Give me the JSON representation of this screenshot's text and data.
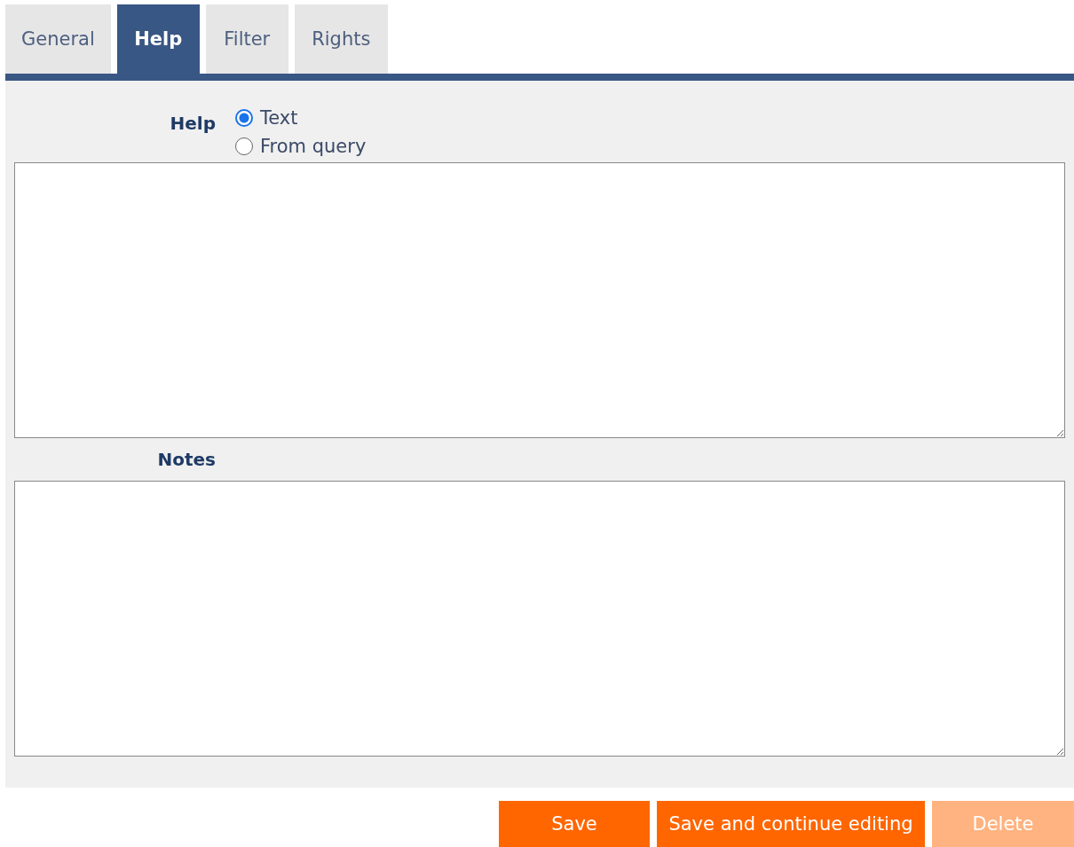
{
  "tabs": [
    {
      "label": "General",
      "selected": false
    },
    {
      "label": "Help",
      "selected": true
    },
    {
      "label": "Filter",
      "selected": false
    },
    {
      "label": "Rights",
      "selected": false
    }
  ],
  "help": {
    "label": "Help",
    "options": [
      {
        "label": "Text",
        "selected": true
      },
      {
        "label": "From query",
        "selected": false
      }
    ]
  },
  "notes": {
    "label": "Notes"
  },
  "buttons": [
    {
      "label": "Save",
      "disabled": false
    },
    {
      "label": "Save and continue editing",
      "disabled": false
    },
    {
      "label": "Delete",
      "disabled": true
    }
  ]
}
